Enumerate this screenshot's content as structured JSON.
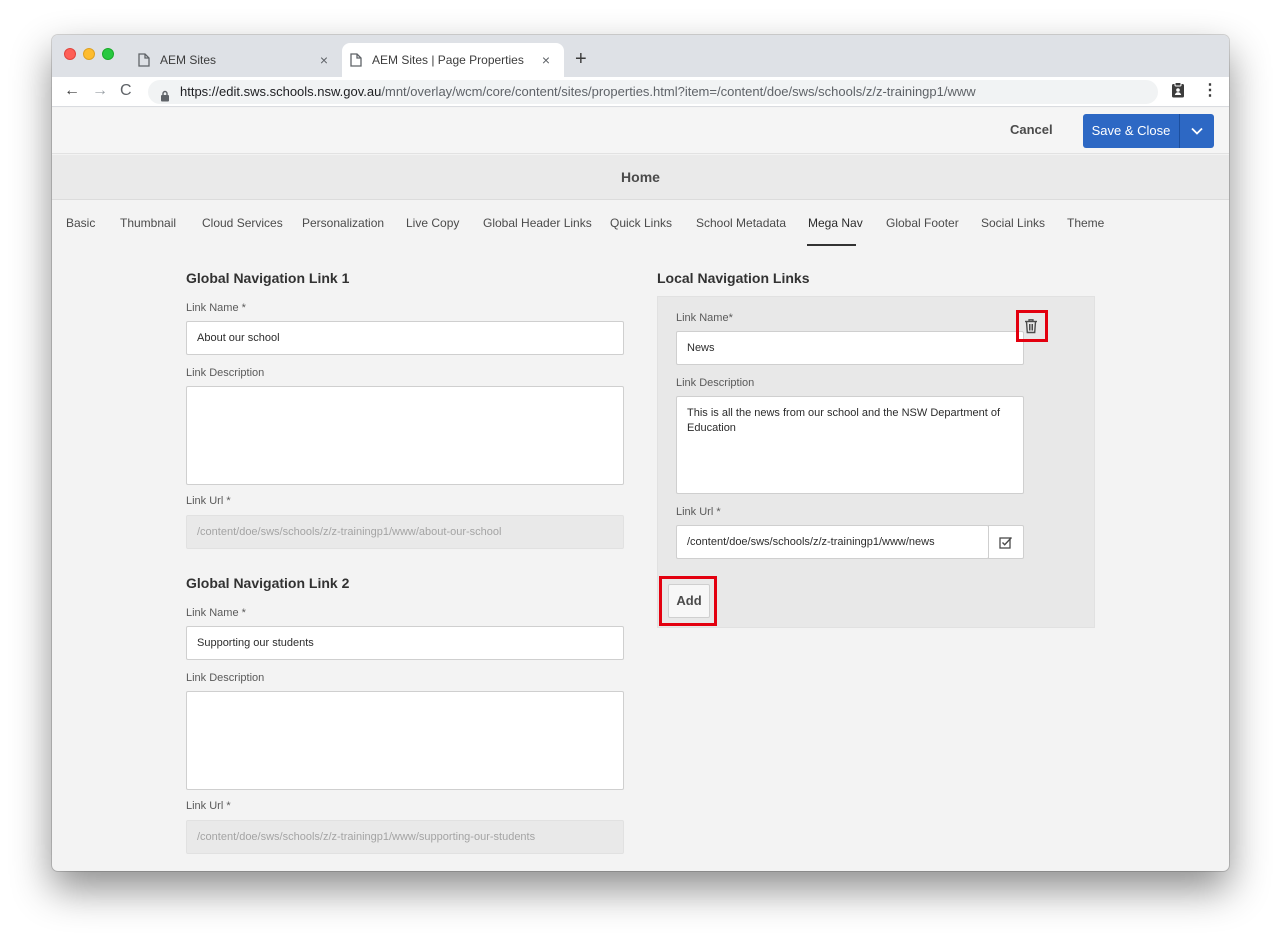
{
  "browser": {
    "tabs": [
      {
        "title": "AEM Sites",
        "close": "×"
      },
      {
        "title": "AEM Sites | Page Properties",
        "close": "×"
      }
    ],
    "new_tab": "+",
    "url_host": "https://edit.sws.schools.nsw.gov.au",
    "url_path": "/mnt/overlay/wcm/core/content/sites/properties.html?item=/content/doe/sws/schools/z/z-trainingp1/www",
    "nav": {
      "back": "←",
      "forward": "→",
      "reload": "C",
      "menu": "⋮"
    }
  },
  "actions": {
    "cancel_label": "Cancel",
    "save_label": "Save & Close"
  },
  "page_title": "Home",
  "property_tabs": [
    "Basic",
    "Thumbnail",
    "Cloud Services",
    "Personalization",
    "Live Copy",
    "Global Header Links",
    "Quick Links",
    "School Metadata",
    "Mega Nav",
    "Global Footer",
    "Social Links",
    "Theme"
  ],
  "selected_tab": "Mega Nav",
  "global_nav": [
    {
      "title": "Global Navigation Link 1",
      "name_label": "Link Name *",
      "name_value": "About our school",
      "desc_label": "Link Description",
      "desc_value": "",
      "url_label": "Link Url *",
      "url_value": "/content/doe/sws/schools/z/z-trainingp1/www/about-our-school"
    },
    {
      "title": "Global Navigation Link 2",
      "name_label": "Link Name *",
      "name_value": "Supporting our students",
      "desc_label": "Link Description",
      "desc_value": "",
      "url_label": "Link Url *",
      "url_value": "/content/doe/sws/schools/z/z-trainingp1/www/supporting-our-students"
    }
  ],
  "local_nav": {
    "title": "Local Navigation Links",
    "name_label": "Link Name*",
    "name_value": "News",
    "desc_label": "Link Description",
    "desc_value": "This is all the news from our school and the NSW Department of Education",
    "url_label": "Link Url *",
    "url_value": "/content/doe/sws/schools/z/z-trainingp1/www/news",
    "add_label": "Add"
  },
  "colors": {
    "accent": "#2d68c4",
    "highlight": "#e3000f"
  },
  "icons": [
    "doc-icon",
    "lock-icon",
    "clipboard-icon",
    "chevron-down-icon",
    "trash-icon",
    "path-browse-icon"
  ]
}
